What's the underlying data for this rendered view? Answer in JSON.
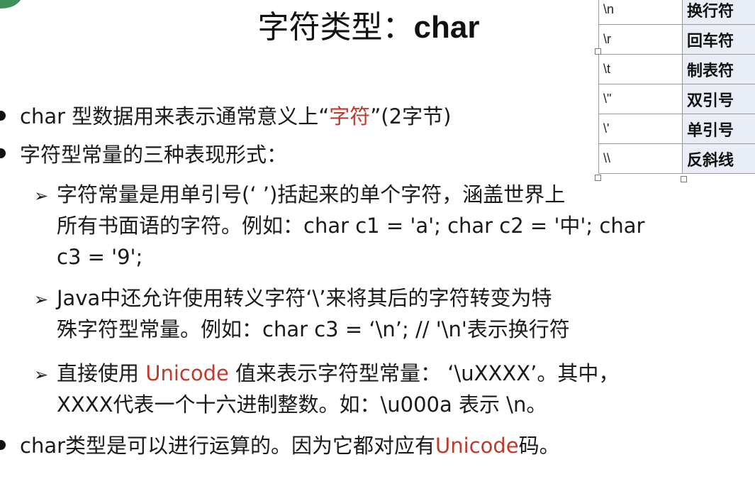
{
  "title": {
    "cn": "字符类型：",
    "latin": "char"
  },
  "escape_table": [
    {
      "seq": "\\n",
      "desc": "换行符"
    },
    {
      "seq": "\\r",
      "desc": "回车符"
    },
    {
      "seq": "\\t",
      "desc": "制表符"
    },
    {
      "seq": "\\\"",
      "desc": "双引号"
    },
    {
      "seq": "\\'",
      "desc": "单引号"
    },
    {
      "seq": "\\\\",
      "desc": "反斜线"
    }
  ],
  "bullets": {
    "b1": {
      "pre": "char 型数据用来表示通常意义上“",
      "red": "字符",
      "post": "”(2字节)"
    },
    "b2": "字符型常量的三种表现形式：",
    "s1": {
      "line1": "字符常量是用单引号(‘ ’)括起来的单个字符，涵盖世界上",
      "line2": "所有书面语的字符。例如：char  c1 = 'a';   char c2 = '中'; char",
      "line3": "c3 =  '9';"
    },
    "s2": {
      "line1": "Java中还允许使用转义字符‘\\’来将其后的字符转变为特",
      "line2": "殊字符型常量。例如：char  c3 = ‘\\n’;  // '\\n'表示换行符"
    },
    "s3": {
      "pre": "直接使用 ",
      "red": "Unicode",
      "post": " 值来表示字符型常量：   ‘\\uXXXX’。其中，",
      "line2": "XXXX代表一个十六进制整数。如：\\u000a  表示 \\n。"
    },
    "b3": {
      "pre": "char类型是可以进行运算的。因为它都对应有",
      "red": "Unicode",
      "post": "码。"
    }
  },
  "colors": {
    "accent_red": "#c0392b",
    "table_desc_bg": "#e9edf5"
  }
}
